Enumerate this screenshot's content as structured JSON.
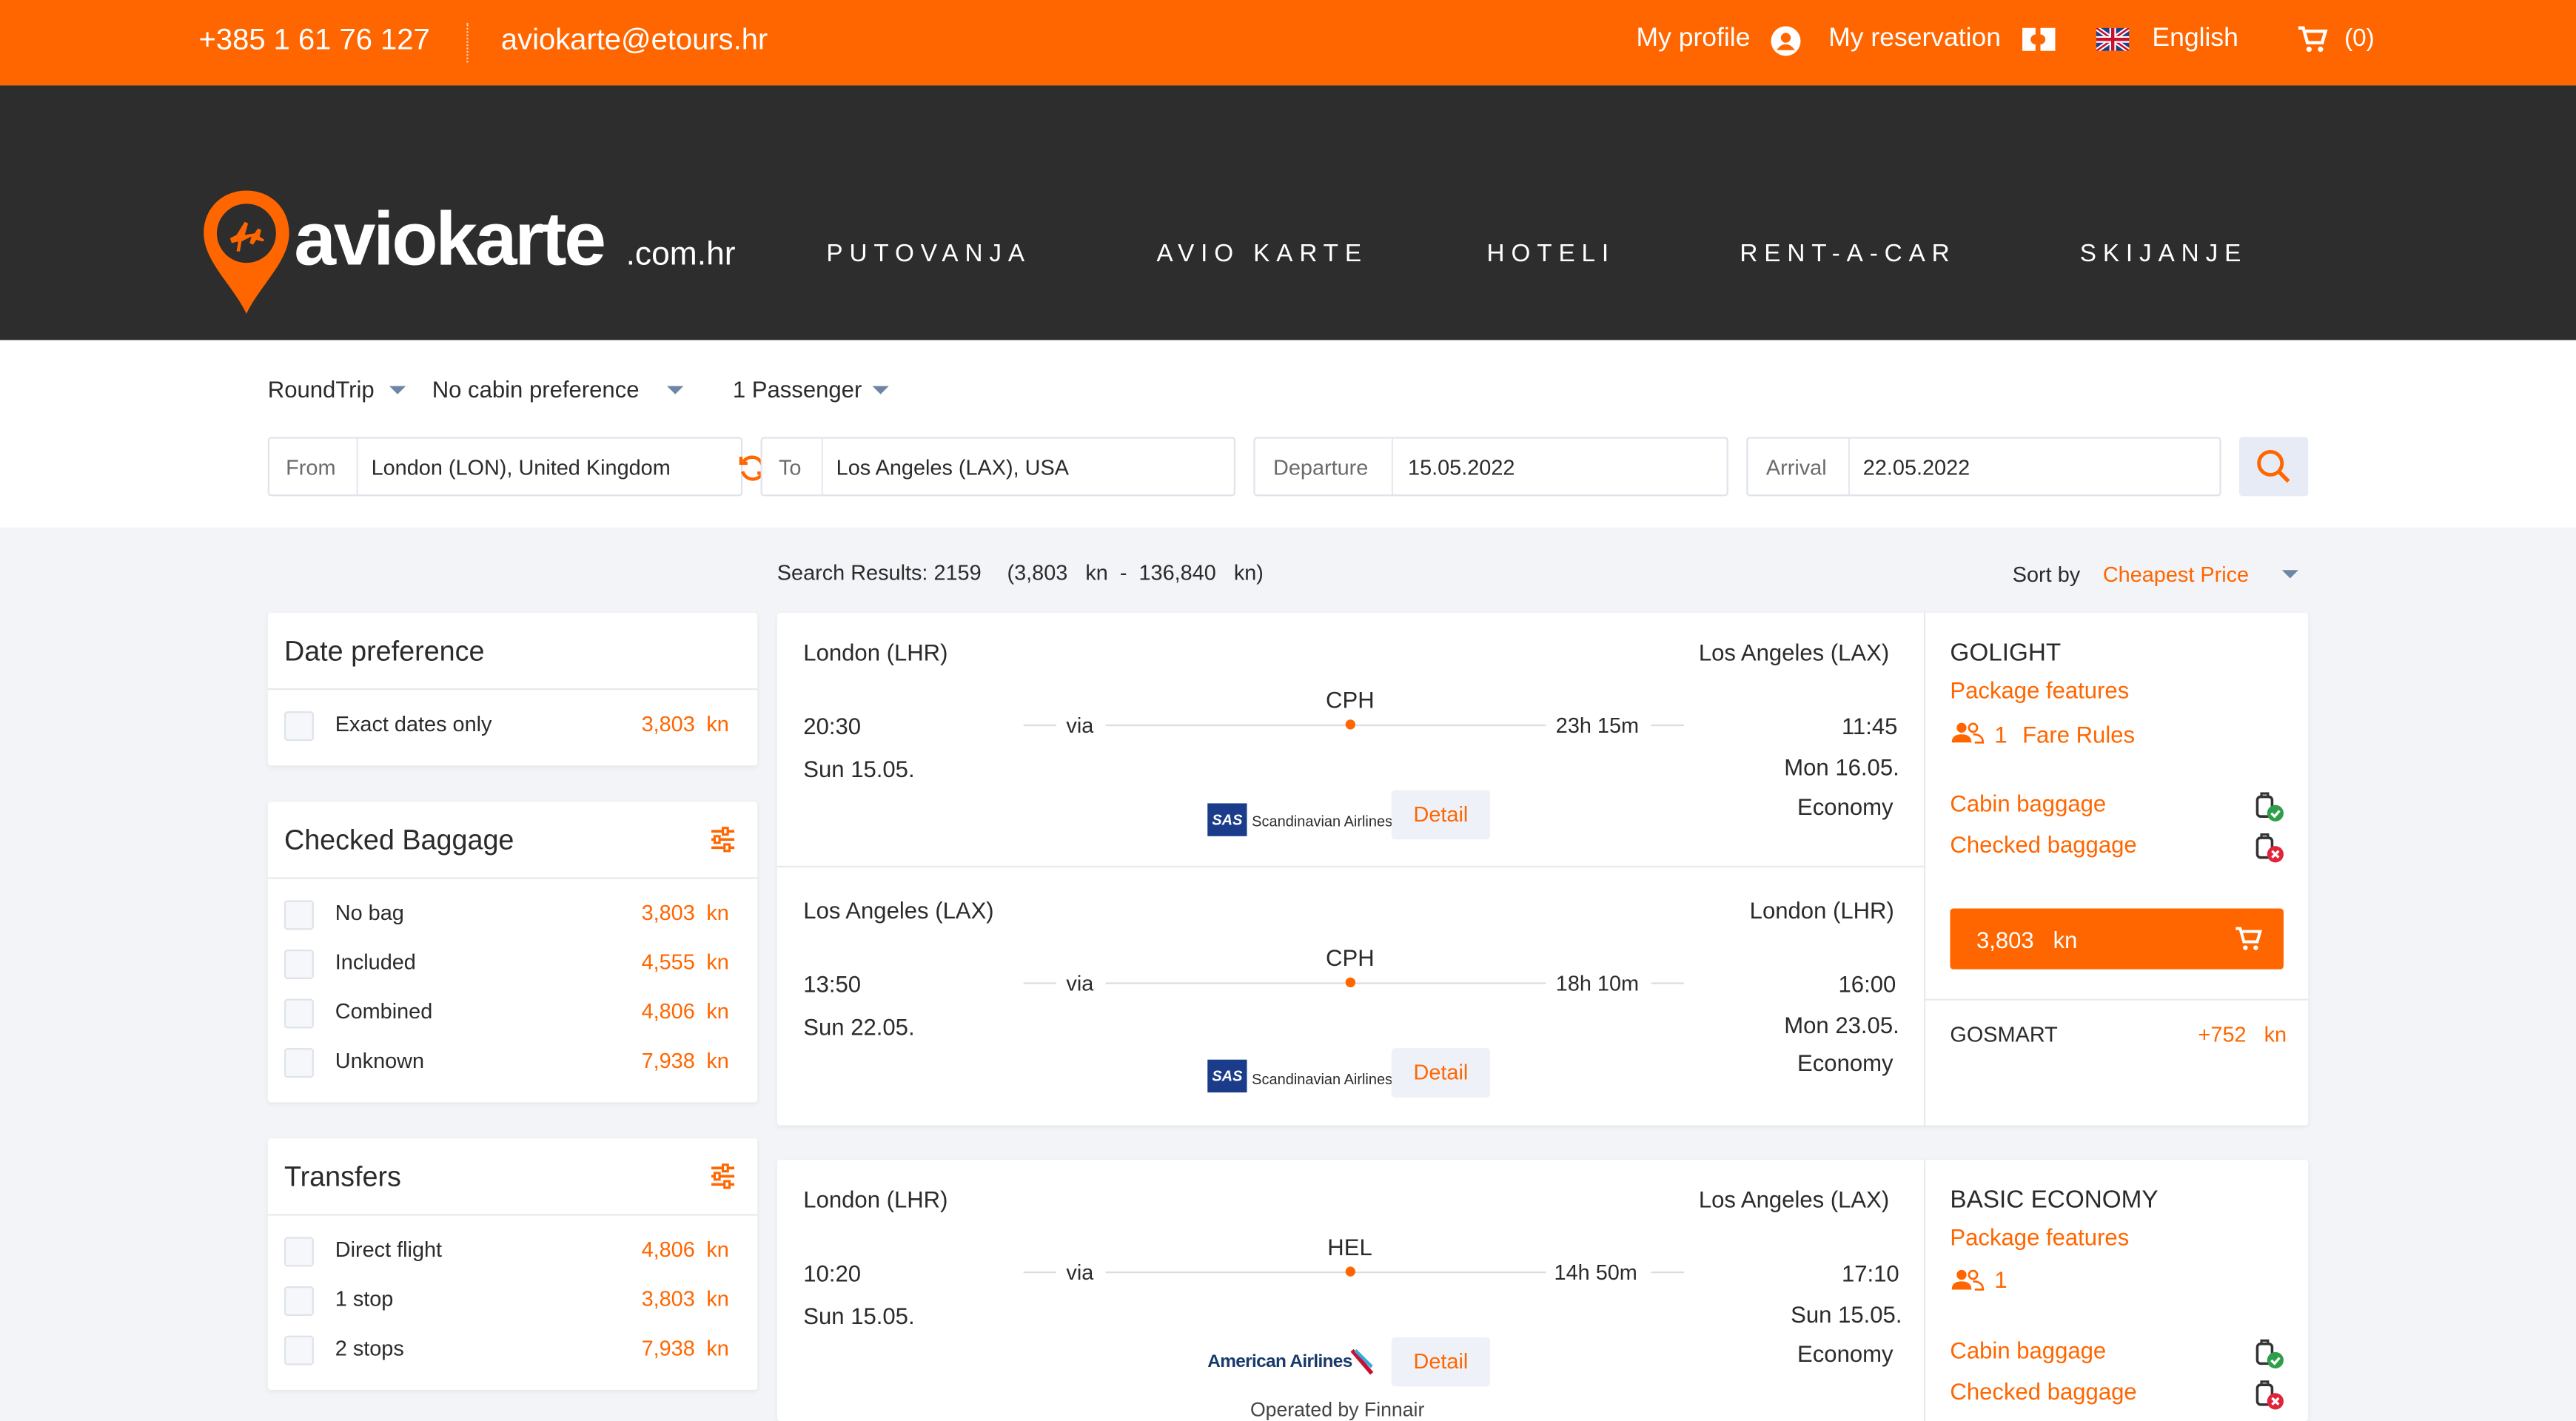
{
  "topbar": {
    "phone": "+385 1 61 76 127",
    "email": "aviokarte@etours.hr",
    "my_profile": "My profile",
    "my_reservation": "My reservation",
    "language": "English",
    "cart_count": "(0)"
  },
  "brand": {
    "logo_main": "aviokarte",
    "logo_suffix": ".com.hr"
  },
  "nav": [
    "PUTOVANJA",
    "AVIO KARTE",
    "HOTELI",
    "RENT-A-CAR",
    "SKIJANJE"
  ],
  "search": {
    "trip_type": "RoundTrip",
    "cabin": "No cabin preference",
    "passengers": "1 Passenger",
    "from_label": "From",
    "from_value": "London (LON), United Kingdom",
    "to_label": "To",
    "to_value": "Los Angeles (LAX), USA",
    "departure_label": "Departure",
    "departure_value": "15.05.2022",
    "arrival_label": "Arrival",
    "arrival_value": "22.05.2022"
  },
  "results": {
    "summary": "Search Results: 2159",
    "range": "(3,803   kn  -  136,840   kn)",
    "sort_label": "Sort by",
    "sort_value": "Cheapest Price"
  },
  "filters": {
    "date": {
      "title": "Date preference",
      "items": [
        {
          "label": "Exact dates only",
          "price": "3,803",
          "cur": "kn"
        }
      ]
    },
    "baggage": {
      "title": "Checked Baggage",
      "items": [
        {
          "label": "No bag",
          "price": "3,803",
          "cur": "kn"
        },
        {
          "label": "Included",
          "price": "4,555",
          "cur": "kn"
        },
        {
          "label": "Combined",
          "price": "4,806",
          "cur": "kn"
        },
        {
          "label": "Unknown",
          "price": "7,938",
          "cur": "kn"
        }
      ]
    },
    "transfers": {
      "title": "Transfers",
      "items": [
        {
          "label": "Direct flight",
          "price": "4,806",
          "cur": "kn"
        },
        {
          "label": "1 stop",
          "price": "3,803",
          "cur": "kn"
        },
        {
          "label": "2 stops",
          "price": "7,938",
          "cur": "kn"
        }
      ]
    }
  },
  "offer1": {
    "out": {
      "from": "London (LHR)",
      "to": "Los Angeles (LAX)",
      "dep": "20:30",
      "dep_date": "Sun 15.05.",
      "via": "via",
      "stop": "CPH",
      "duration": "23h 15m",
      "arr": "11:45",
      "arr_date": "Mon 16.05.",
      "class": "Economy",
      "airline": "Scandinavian Airlines",
      "airline_code": "SAS",
      "detail": "Detail"
    },
    "ret": {
      "from": "Los Angeles (LAX)",
      "to": "London (LHR)",
      "dep": "13:50",
      "dep_date": "Sun 22.05.",
      "via": "via",
      "stop": "CPH",
      "duration": "18h 10m",
      "arr": "16:00",
      "arr_date": "Mon 23.05.",
      "class": "Economy",
      "airline": "Scandinavian Airlines",
      "airline_code": "SAS",
      "detail": "Detail"
    },
    "fare": {
      "name": "GOLIGHT",
      "package": "Package features",
      "pax": "1",
      "fare_rules": "Fare Rules",
      "cabin": "Cabin baggage",
      "checked": "Checked baggage",
      "price": "3,803   kn",
      "alt_name": "GOSMART",
      "alt_price": "+752   kn"
    }
  },
  "offer2": {
    "out": {
      "from": "London (LHR)",
      "to": "Los Angeles (LAX)",
      "dep": "10:20",
      "dep_date": "Sun 15.05.",
      "via": "via",
      "stop": "HEL",
      "duration": "14h 50m",
      "arr": "17:10",
      "arr_date": "Sun 15.05.",
      "class": "Economy",
      "airline": "American Airlines",
      "detail": "Detail",
      "operated": "Operated by Finnair"
    },
    "fare": {
      "name": "BASIC ECONOMY",
      "package": "Package features",
      "pax": "1",
      "cabin": "Cabin baggage",
      "checked": "Checked baggage"
    }
  },
  "colors": {
    "accent": "#ff6600",
    "header": "#2d2d2d",
    "page_bg": "#f2f4f7"
  }
}
